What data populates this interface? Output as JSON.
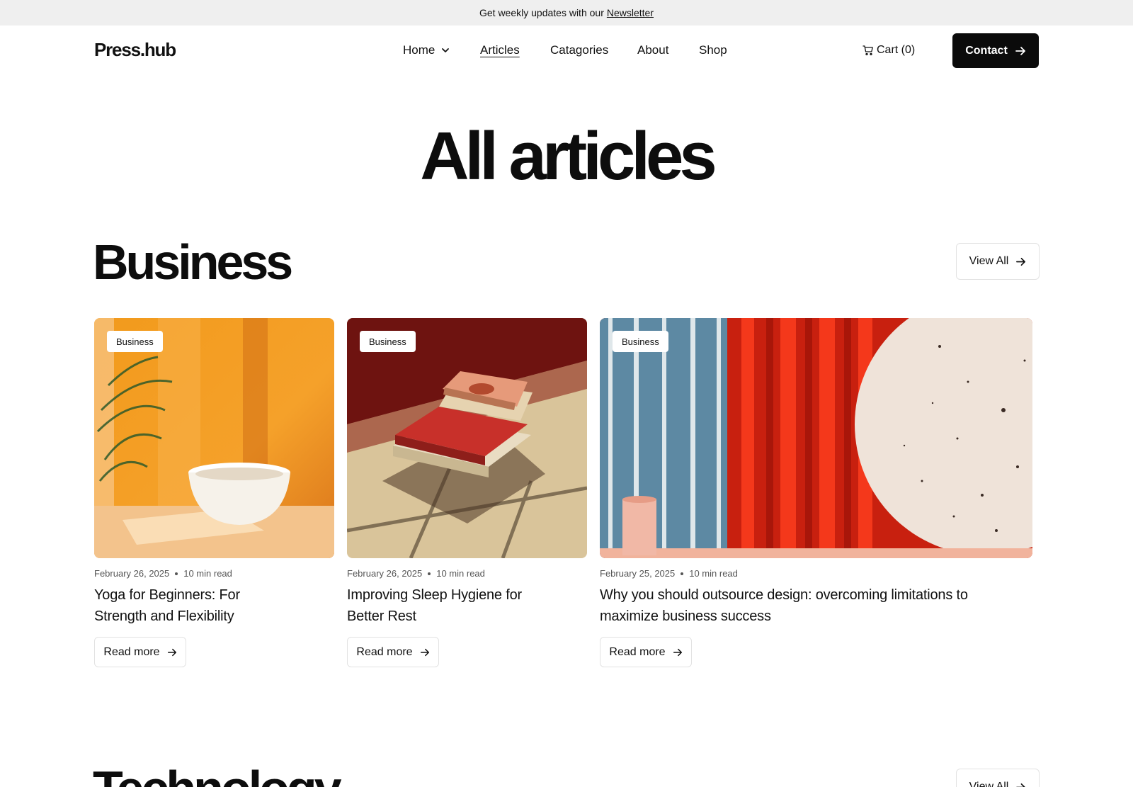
{
  "announcement": {
    "text": "Get weekly updates with our",
    "link": "Newsletter"
  },
  "header": {
    "logo": "Press.hub",
    "nav": [
      {
        "label": "Home",
        "has_dropdown": true,
        "active": false
      },
      {
        "label": "Articles",
        "has_dropdown": false,
        "active": true
      },
      {
        "label": "Catagories",
        "has_dropdown": false,
        "active": false
      },
      {
        "label": "About",
        "has_dropdown": false,
        "active": false
      },
      {
        "label": "Shop",
        "has_dropdown": false,
        "active": false
      }
    ],
    "cart_label": "Cart (0)",
    "contact_label": "Contact"
  },
  "page_title": "All articles",
  "sections": [
    {
      "title": "Business",
      "view_all_label": "View All",
      "articles": [
        {
          "tag": "Business",
          "date": "February 26, 2025",
          "read_time": "10 min read",
          "title": "Yoga for Beginners: For Strength and Flexibility",
          "cta": "Read more"
        },
        {
          "tag": "Business",
          "date": "February 26, 2025",
          "read_time": "10 min read",
          "title": "Improving Sleep Hygiene for Better Rest",
          "cta": "Read more"
        },
        {
          "tag": "Business",
          "date": "February 25, 2025",
          "read_time": "10 min read",
          "title": "Why you should outsource design: overcoming limitations to maximize business success",
          "cta": "Read more"
        }
      ]
    },
    {
      "title": "Technology",
      "view_all_label": "View All"
    }
  ],
  "colors": {
    "accent": "#0b0b0b",
    "announcement_bg": "#efefef",
    "border": "#e2e2e2"
  }
}
